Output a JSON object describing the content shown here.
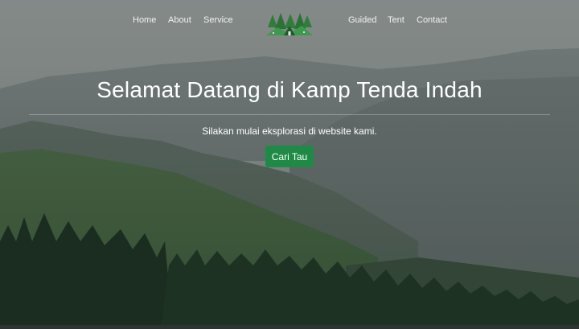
{
  "nav": {
    "left_items": [
      "Home",
      "About",
      "Service"
    ],
    "right_items": [
      "Guided",
      "Tent",
      "Contact"
    ],
    "logo_icon": "tent-forest-logo"
  },
  "hero": {
    "title": "Selamat Datang di Kamp Tenda Indah",
    "subtitle": "Silakan mulai eksplorasi di website kami.",
    "cta_label": "Cari Tau"
  },
  "colors": {
    "cta_green": "#1f8a45",
    "logo_green": "#2e7d3a",
    "text": "#ffffff"
  }
}
